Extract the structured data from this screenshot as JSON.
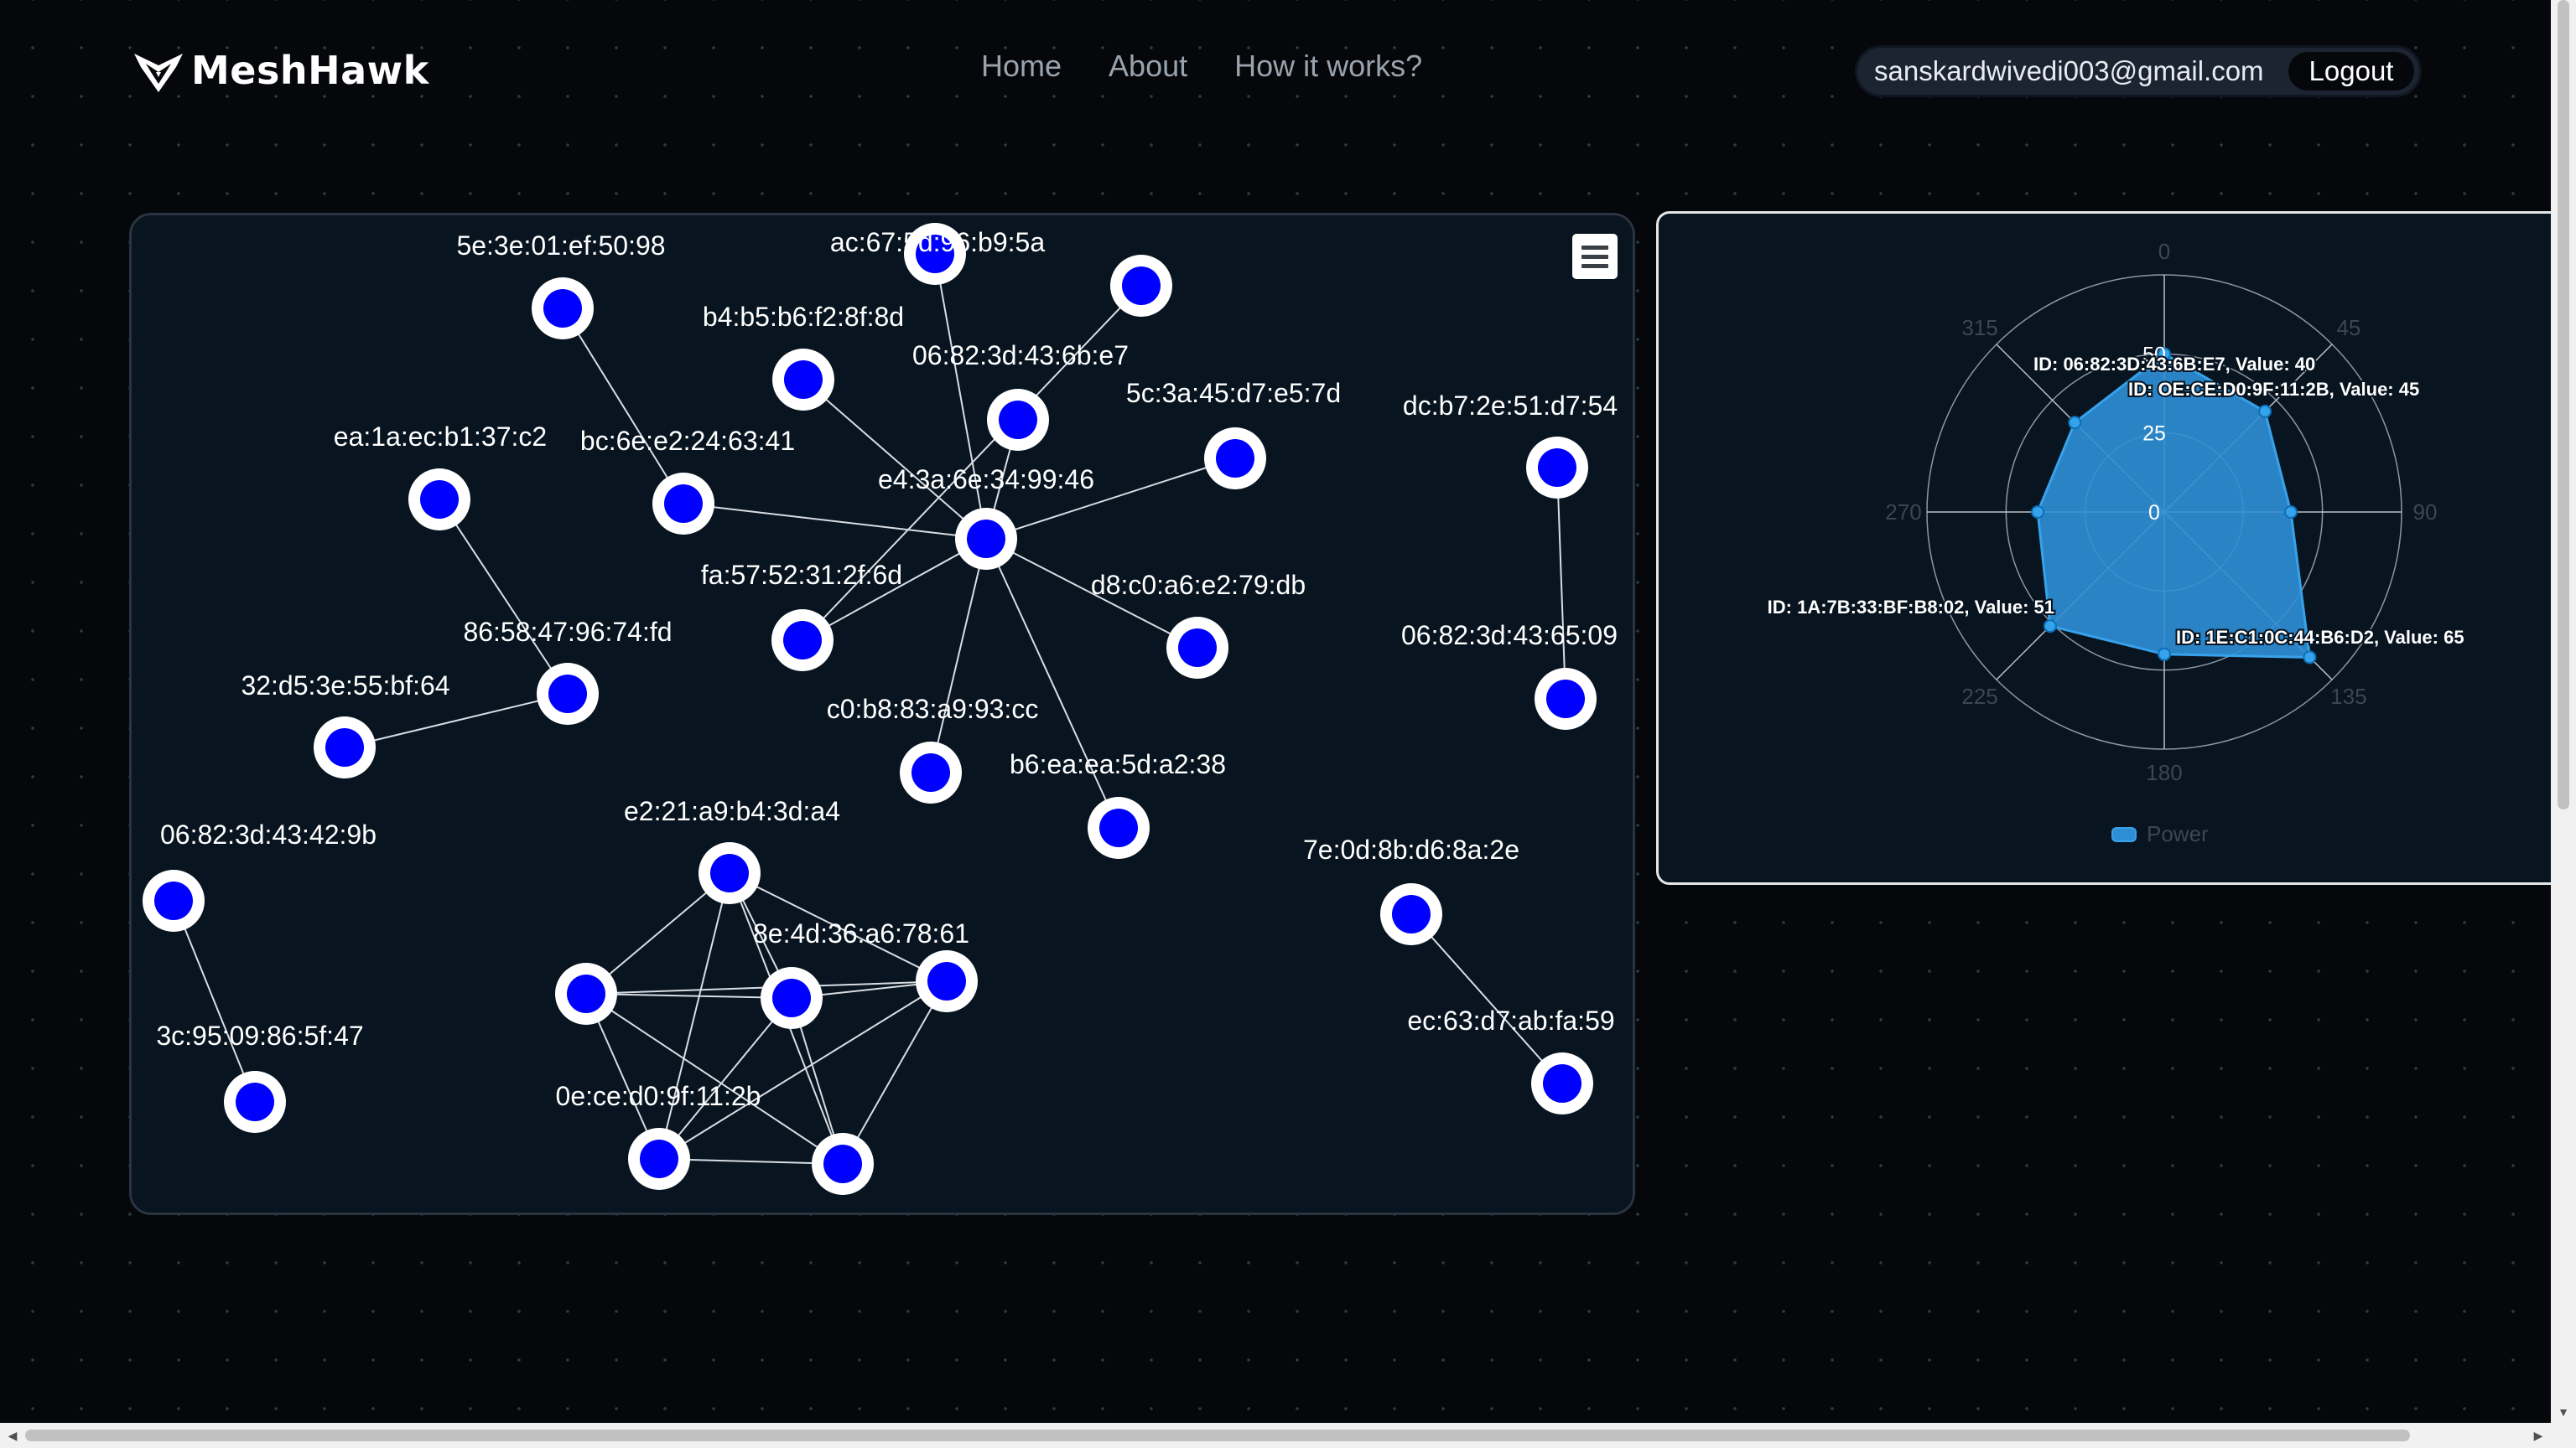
{
  "app": {
    "name": "MeshHawk"
  },
  "nav": {
    "items": [
      "Home",
      "About",
      "How it works?"
    ]
  },
  "user": {
    "email": "sanskardwivedi003@gmail.com",
    "logout_label": "Logout"
  },
  "colors": {
    "node_fill": "#0000ff",
    "node_ring": "#ffffff",
    "edge": "#d8dde4",
    "radar_fill": "#2f8fd6",
    "radar_stroke": "#36a2eb"
  },
  "graph": {
    "nodes": [
      {
        "id": "n1",
        "label": "5e:3e:01:ef:50:98"
      },
      {
        "id": "n2",
        "label": "ac:67:5d:96:b9:5a"
      },
      {
        "id": "n3",
        "label": ""
      },
      {
        "id": "n4",
        "label": "b4:b5:b6:f2:8f:8d"
      },
      {
        "id": "n5",
        "label": "06:82:3d:43:6b:e7"
      },
      {
        "id": "n6",
        "label": "5c:3a:45:d7:e5:7d"
      },
      {
        "id": "n7",
        "label": "dc:b7:2e:51:d7:54"
      },
      {
        "id": "n8",
        "label": "ea:1a:ec:b1:37:c2"
      },
      {
        "id": "n9",
        "label": "bc:6e:e2:24:63:41"
      },
      {
        "id": "n10",
        "label": "e4:3a:6e:34:99:46"
      },
      {
        "id": "n11",
        "label": "fa:57:52:31:2f:6d"
      },
      {
        "id": "n12",
        "label": "d8:c0:a6:e2:79:db"
      },
      {
        "id": "n13",
        "label": "86:58:47:96:74:fd"
      },
      {
        "id": "n14",
        "label": "06:82:3d:43:65:09"
      },
      {
        "id": "n15",
        "label": "32:d5:3e:55:bf:64"
      },
      {
        "id": "n16",
        "label": "c0:b8:83:a9:93:cc"
      },
      {
        "id": "n17",
        "label": "b6:ea:ea:5d:a2:38"
      },
      {
        "id": "n18",
        "label": "e2:21:a9:b4:3d:a4"
      },
      {
        "id": "n19",
        "label": "06:82:3d:43:42:9b"
      },
      {
        "id": "n20",
        "label": "7e:0d:8b:d6:8a:2e"
      },
      {
        "id": "n21",
        "label": ""
      },
      {
        "id": "n22",
        "label": "8e:4d:36:a6:78:61"
      },
      {
        "id": "n23",
        "label": ""
      },
      {
        "id": "n24",
        "label": "ec:63:d7:ab:fa:59"
      },
      {
        "id": "n25",
        "label": "3c:95:09:86:5f:47"
      },
      {
        "id": "n26",
        "label": "0e:ce:d0:9f:11:2b"
      },
      {
        "id": "n27",
        "label": ""
      }
    ],
    "edges": [
      [
        "n1",
        "n9"
      ],
      [
        "n2",
        "n10"
      ],
      [
        "n3",
        "n11"
      ],
      [
        "n4",
        "n10"
      ],
      [
        "n5",
        "n10"
      ],
      [
        "n6",
        "n10"
      ],
      [
        "n9",
        "n10"
      ],
      [
        "n11",
        "n10"
      ],
      [
        "n12",
        "n10"
      ],
      [
        "n16",
        "n10"
      ],
      [
        "n17",
        "n10"
      ],
      [
        "n7",
        "n14"
      ],
      [
        "n8",
        "n13"
      ],
      [
        "n13",
        "n15"
      ],
      [
        "n19",
        "n25"
      ],
      [
        "n20",
        "n24"
      ],
      [
        "n18",
        "n21"
      ],
      [
        "n18",
        "n22"
      ],
      [
        "n18",
        "n23"
      ],
      [
        "n18",
        "n26"
      ],
      [
        "n18",
        "n27"
      ],
      [
        "n21",
        "n22"
      ],
      [
        "n21",
        "n23"
      ],
      [
        "n21",
        "n26"
      ],
      [
        "n21",
        "n27"
      ],
      [
        "n22",
        "n23"
      ],
      [
        "n22",
        "n26"
      ],
      [
        "n22",
        "n27"
      ],
      [
        "n23",
        "n26"
      ],
      [
        "n23",
        "n27"
      ],
      [
        "n26",
        "n27"
      ]
    ]
  },
  "chart_data": {
    "type": "radar",
    "angle_ticks": [
      "0",
      "45",
      "90",
      "135",
      "180",
      "225",
      "270",
      "315"
    ],
    "radial_ticks": [
      "0",
      "25",
      "50"
    ],
    "rlim": [
      0,
      75
    ],
    "legend": {
      "label": "Power",
      "position": "bottom"
    },
    "series": [
      {
        "name": "Power",
        "points": [
          {
            "angle": 0,
            "value": 50
          },
          {
            "angle": 45,
            "value": 45
          },
          {
            "angle": 90,
            "value": 40
          },
          {
            "angle": 135,
            "value": 65
          },
          {
            "angle": 180,
            "value": 45
          },
          {
            "angle": 225,
            "value": 51
          },
          {
            "angle": 270,
            "value": 40
          },
          {
            "angle": 315,
            "value": 40
          }
        ]
      }
    ],
    "annotations": [
      "ID: 06:82:3D:43:6B:E7, Value: 40",
      "ID: OE:CE:D0:9F:11:2B, Value: 45",
      "ID: 1A:7B:33:BF:B8:02, Value: 51",
      "ID: 1E:C1:0C:44:B6:D2, Value: 65"
    ]
  }
}
